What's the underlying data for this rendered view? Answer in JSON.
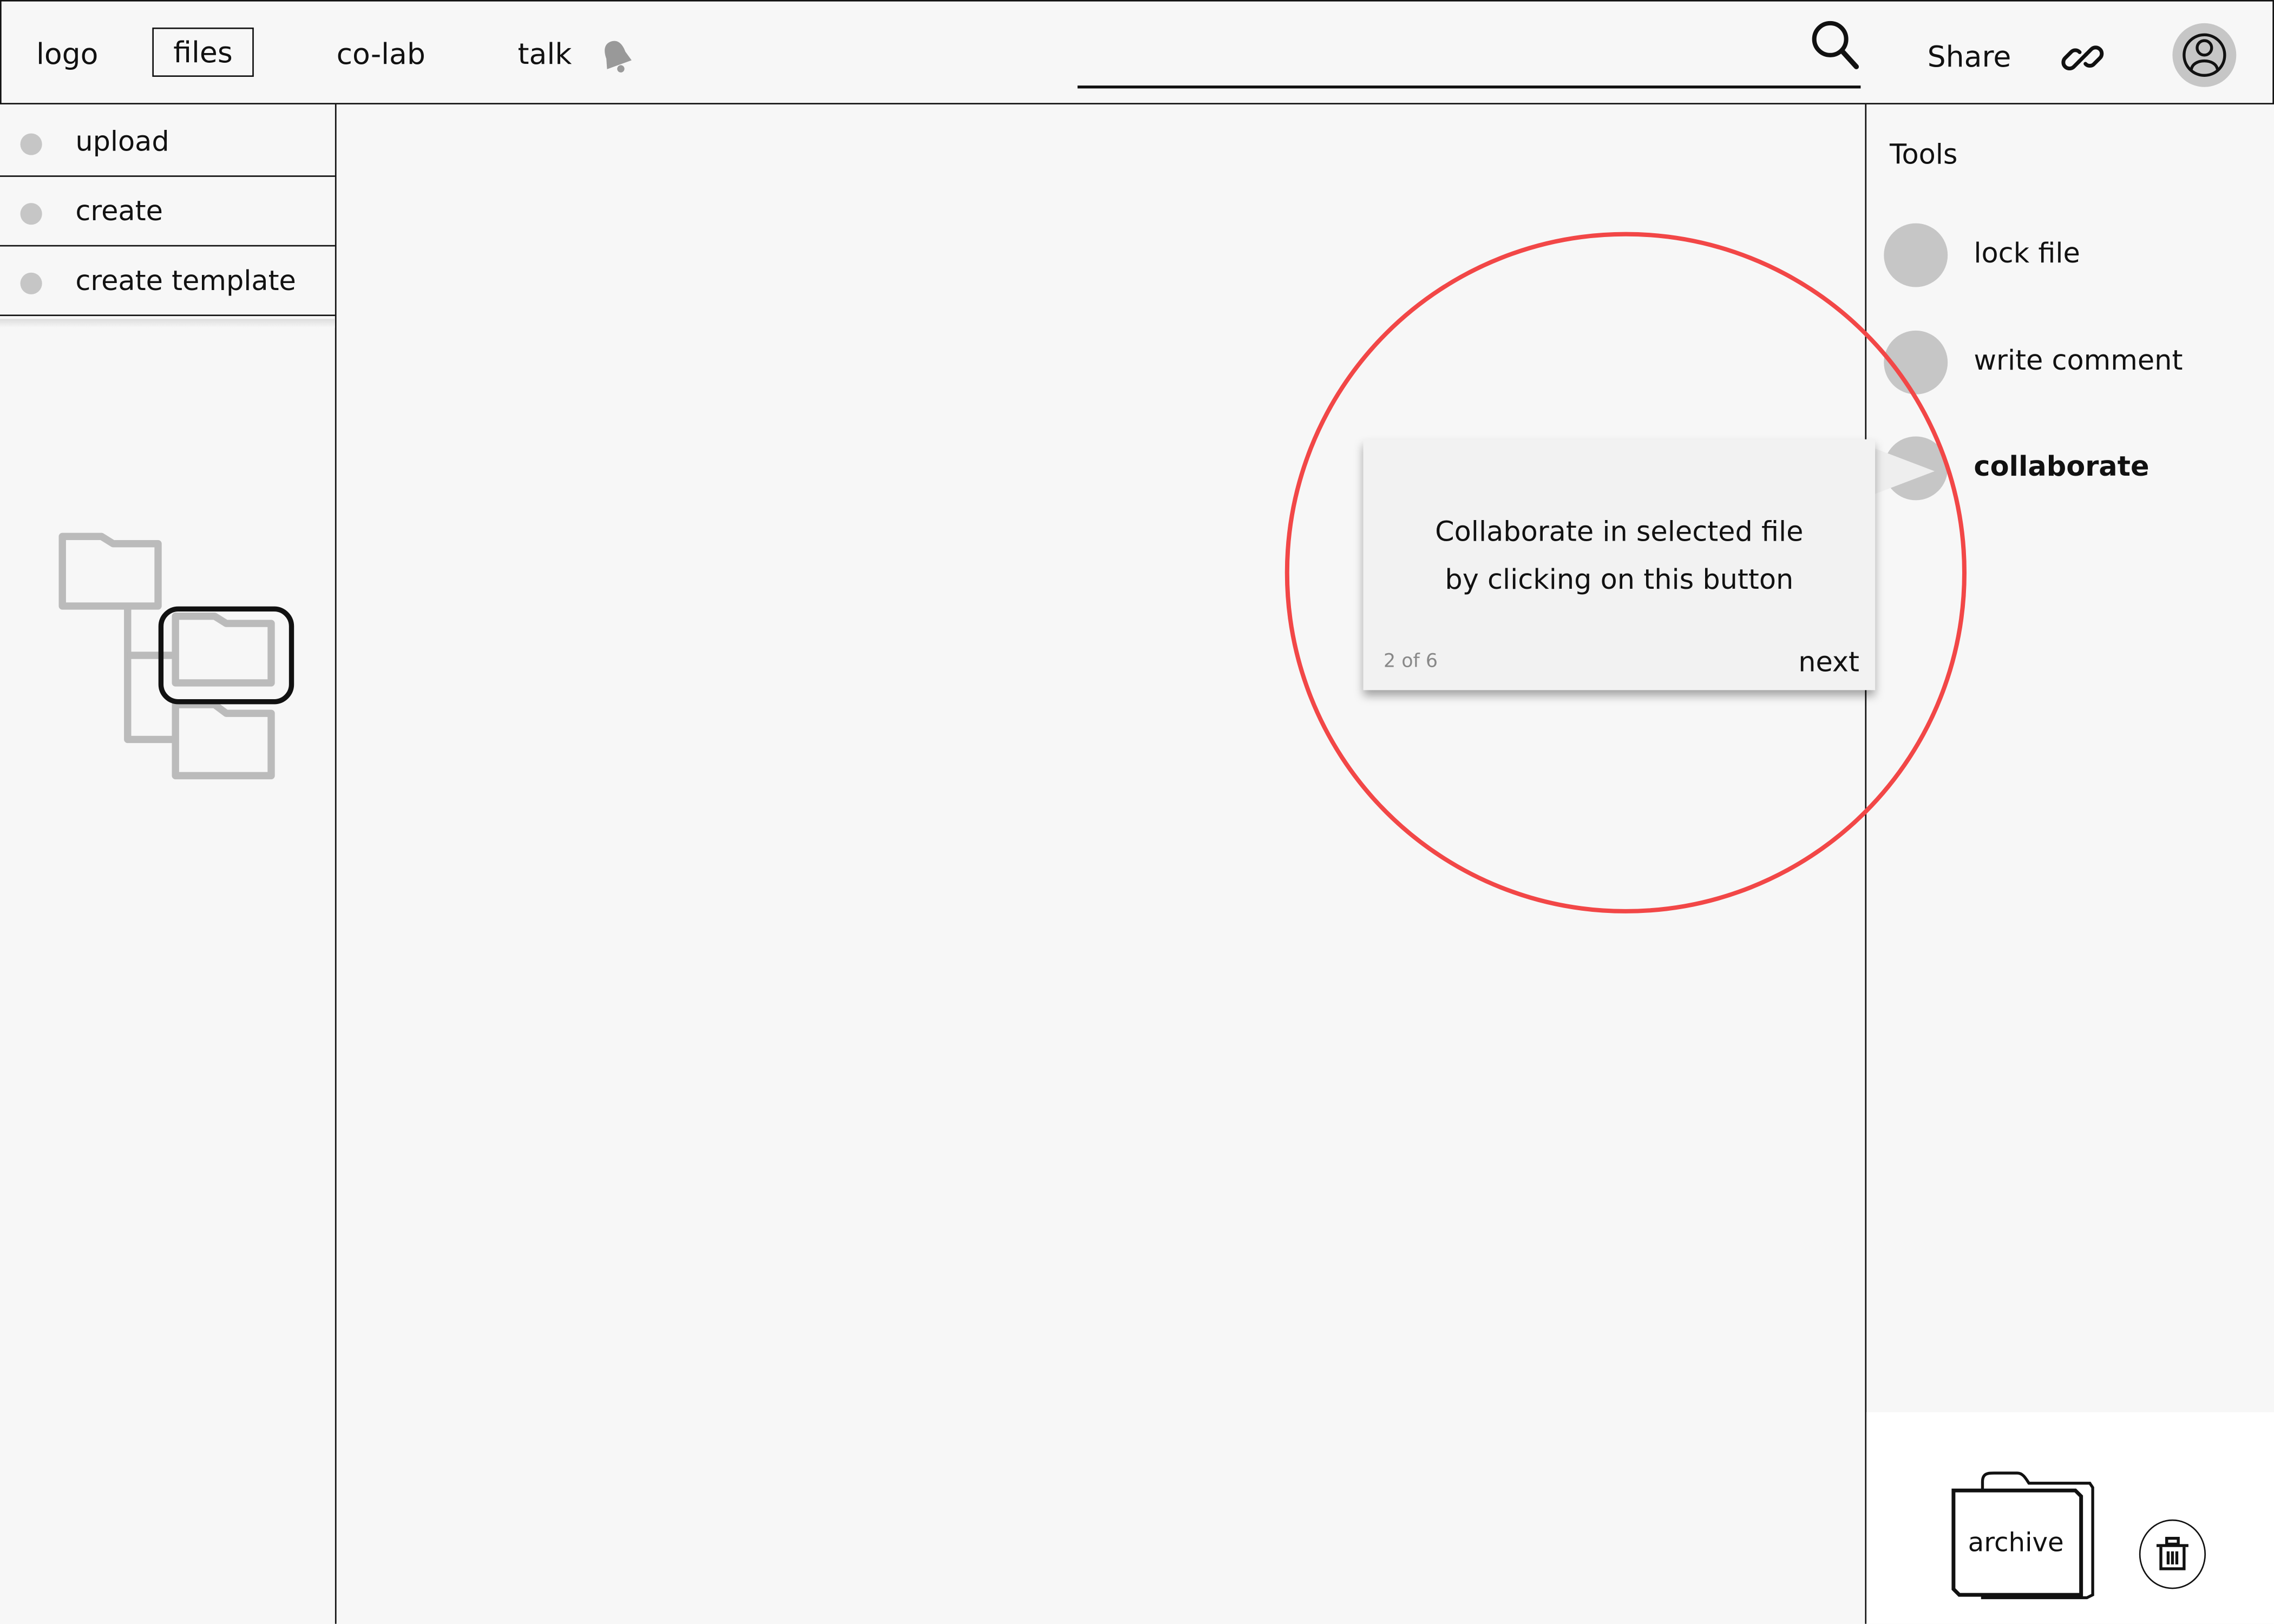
{
  "header": {
    "nav": [
      {
        "label": "logo"
      },
      {
        "label": "files",
        "active": true
      },
      {
        "label": "co-lab"
      },
      {
        "label": "talk"
      }
    ],
    "notification_icon": "bell-icon",
    "search": {
      "value": "",
      "placeholder": "",
      "icon": "search-icon"
    },
    "share_label": "Share",
    "link_icon": "link-icon",
    "avatar_icon": "user-avatar-icon"
  },
  "left_sidebar": {
    "items": [
      {
        "label": "upload"
      },
      {
        "label": "create"
      },
      {
        "label": "create template"
      }
    ],
    "folder_tree": {
      "folders": [
        "root-folder",
        "child-folder-selected",
        "child-folder"
      ],
      "selected_index": 1
    }
  },
  "right_panel": {
    "title": "Tools",
    "tools": [
      {
        "label": "lock file"
      },
      {
        "label": "write comment"
      },
      {
        "label": "collaborate",
        "highlighted": true
      }
    ],
    "archive_label": "archive",
    "trash_icon": "trash-icon"
  },
  "tooltip": {
    "line1": "Collaborate in selected file",
    "line2": "by clicking on this button",
    "step": "2 of 6",
    "next_label": "next"
  },
  "colors": {
    "highlight": "#f24747",
    "background": "#f7f7f7",
    "placeholder_gray": "#c6c6c6"
  }
}
